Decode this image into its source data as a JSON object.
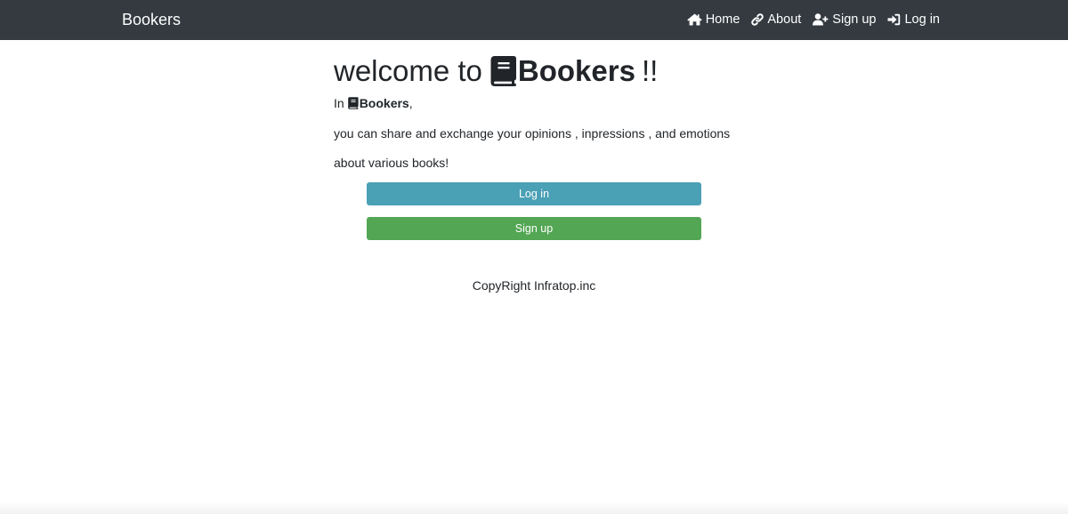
{
  "navbar": {
    "brand": "Bookers",
    "links": [
      {
        "label": "Home",
        "icon": "home-icon"
      },
      {
        "label": "About",
        "icon": "link-icon"
      },
      {
        "label": "Sign up",
        "icon": "user-plus-icon"
      },
      {
        "label": "Log in",
        "icon": "sign-in-icon"
      }
    ]
  },
  "hero": {
    "title_prefix": "welcome to ",
    "title_brand": "Bookers",
    "title_suffix": "!!",
    "line1_prefix": "In ",
    "line1_brand": "Bookers",
    "line1_suffix": ",",
    "line2": "you can share and exchange your opinions , inpressions , and emotions",
    "line3": "about various books!"
  },
  "buttons": {
    "login": "Log in",
    "signup": "Sign up"
  },
  "footer": {
    "text": "CopyRight Infratop.inc"
  },
  "colors": {
    "navbar_bg": "#343a40",
    "login_button": "#4aa0b5",
    "signup_button": "#53a654",
    "text": "#212529"
  }
}
